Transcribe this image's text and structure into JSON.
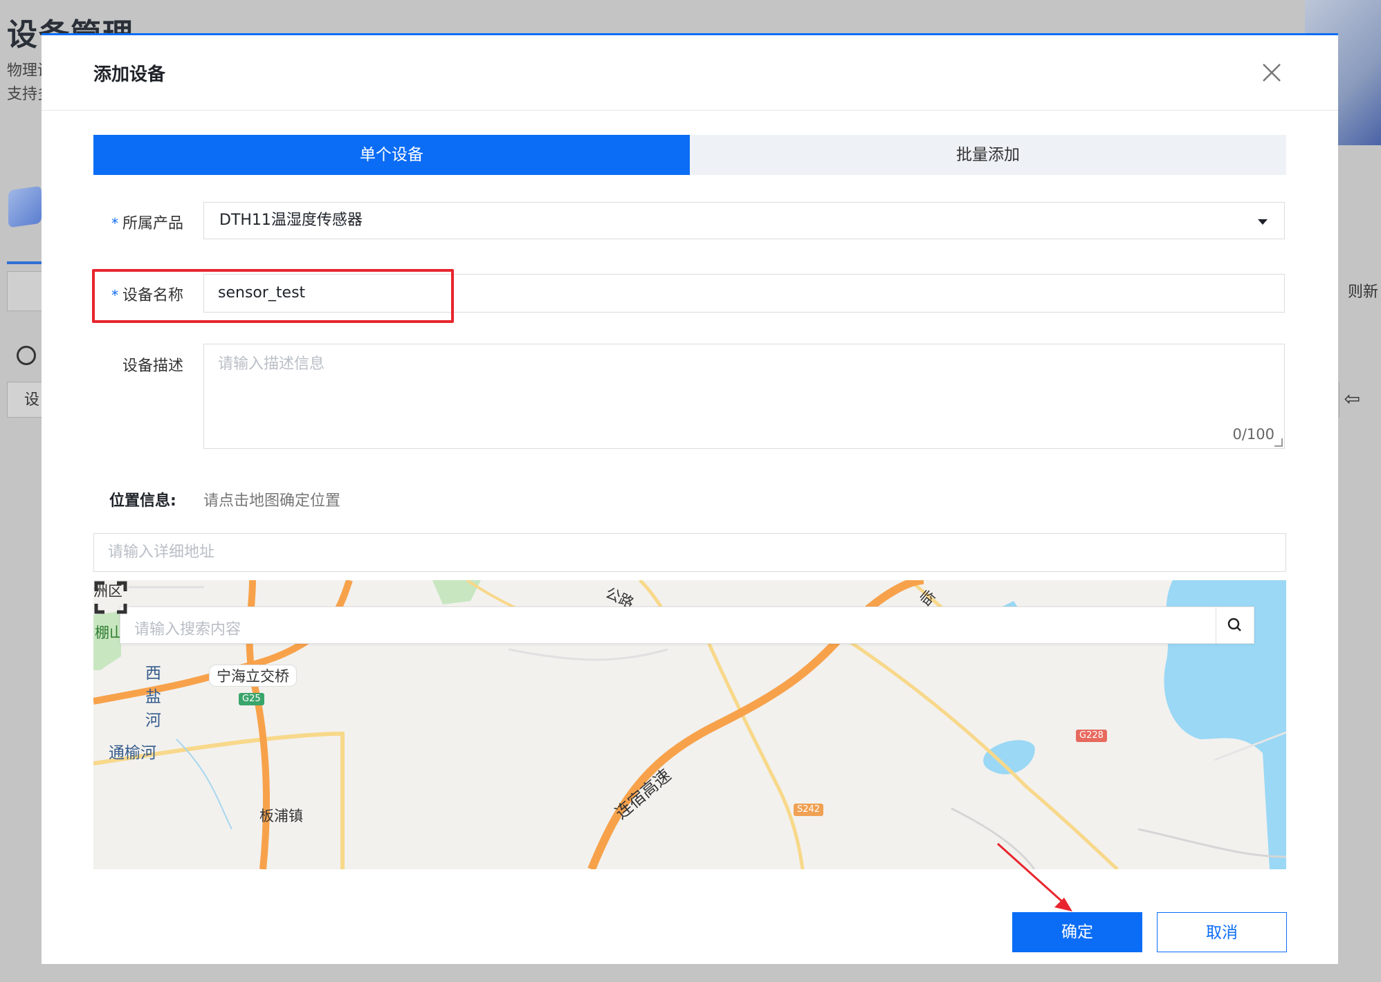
{
  "background": {
    "page_title": "设备管理",
    "desc_line1": "物理设",
    "desc_line2": "支持多",
    "tab_button_label": "设",
    "right_text": "，则新"
  },
  "modal": {
    "title": "添加设备",
    "tabs": [
      {
        "label": "单个设备",
        "active": true
      },
      {
        "label": "批量添加",
        "active": false
      }
    ],
    "form": {
      "product_label": "所属产品",
      "product_value": "DTH11温湿度传感器",
      "name_label": "设备名称",
      "name_value": "sensor_test",
      "desc_label": "设备描述",
      "desc_placeholder": "请输入描述信息",
      "desc_count": "0/100",
      "required_mark": "*"
    },
    "location": {
      "label": "位置信息:",
      "hint": "请点击地图确定位置",
      "address_placeholder": "请输入详细地址"
    },
    "map": {
      "search_placeholder": "请输入搜索内容",
      "labels": [
        "洲区",
        "棚山",
        "西盐河",
        "宁海立交桥",
        "通榆河",
        "板浦镇",
        "连宿高速",
        "公路",
        "临"
      ],
      "shields": [
        "G25",
        "G228",
        "S242"
      ]
    },
    "footer": {
      "ok_label": "确定",
      "cancel_label": "取消"
    }
  },
  "colors": {
    "primary": "#0b6df5",
    "highlight": "#e8252e",
    "road_orange": "#f7a24b",
    "road_yellow": "#f8d88a",
    "water": "#9ad8f5"
  }
}
